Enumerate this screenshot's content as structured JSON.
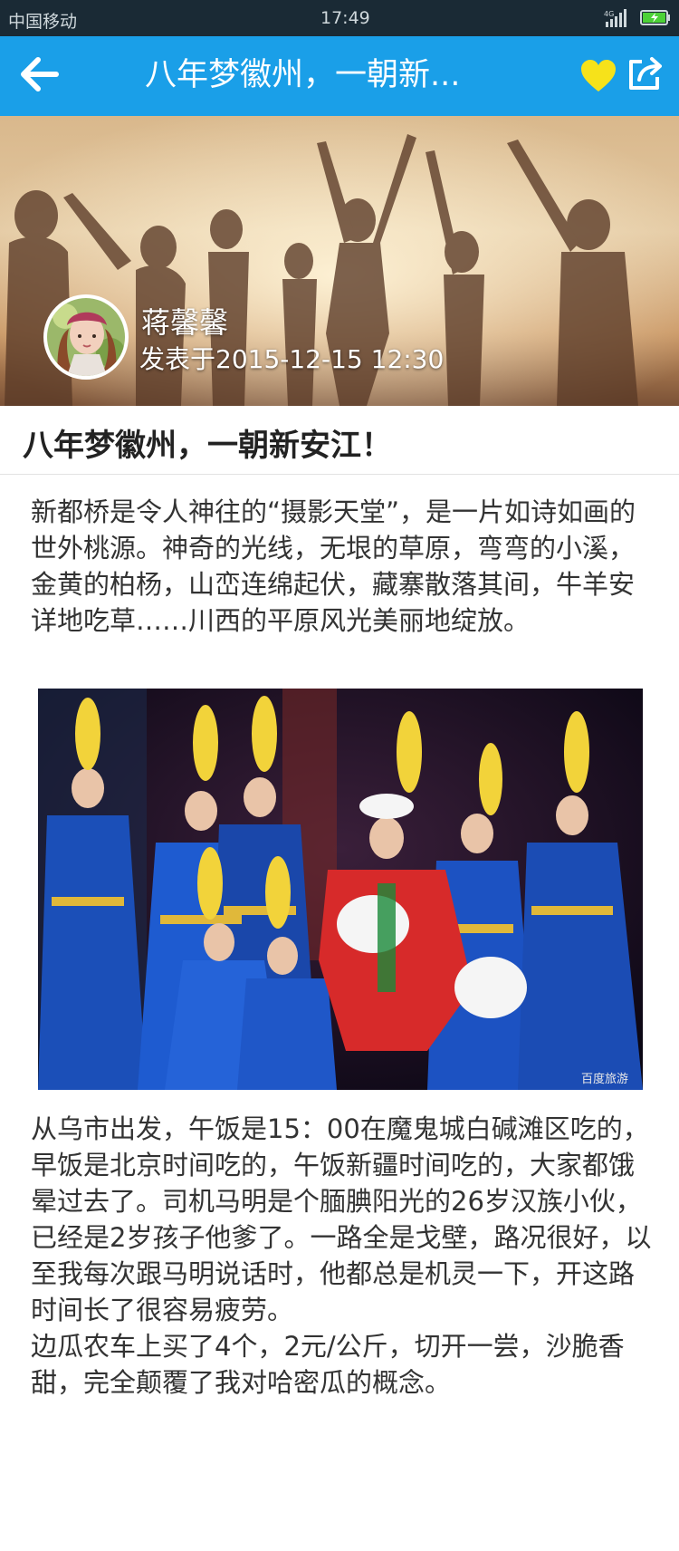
{
  "status_bar": {
    "carrier": "中国移动",
    "time": "17:49",
    "network": "4G"
  },
  "nav": {
    "title": "八年梦徽州，一朝新...",
    "back_icon": "arrow-left-icon",
    "favorite_icon": "heart-icon",
    "share_icon": "share-icon",
    "favorite_color": "#f6e21a"
  },
  "author": {
    "name": "蒋馨馨",
    "posted_at": "发表于2015-12-15  12:30"
  },
  "article": {
    "title": "八年梦徽州，一朝新安江！",
    "paragraph_1": "新都桥是令人神往的“摄影天堂”，是一片如诗如画的世外桃源。神奇的光线，无垠的草原，弯弯的小溪，金黄的柏杨，山峦连绵起伏，藏寨散落其间，牛羊安详地吃草……川西的平原风光美丽地绽放。",
    "paragraph_2": "从乌市出发，午饭是15：00在魔鬼城白碱滩区吃的，早饭是北京时间吃的，午饭新疆时间吃的，大家都饿晕过去了。司机马明是个腼腆阳光的26岁汉族小伙，已经是2岁孩子他爹了。一路全是戈壁，路况很好，以至我每次跟马明说话时，他都总是机灵一下，开这路时间长了很容易疲劳。",
    "paragraph_3": "边瓜农车上买了4个，2元/公斤，切开一尝，沙脆香甜，完全颠覆了我对哈密瓜的概念。",
    "photo_watermark": "百度旅游"
  },
  "colors": {
    "nav_bg": "#1a9fe8",
    "status_bg": "#1a2a35"
  }
}
